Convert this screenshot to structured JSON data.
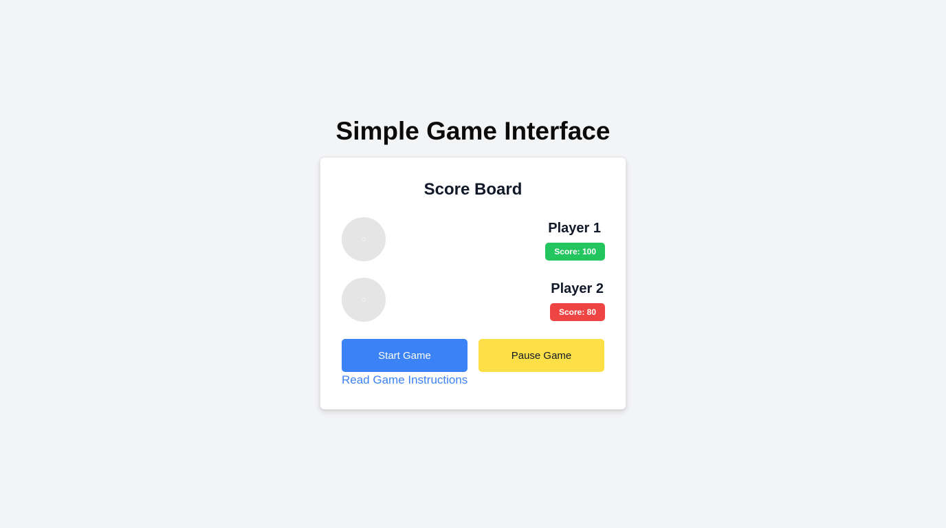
{
  "page": {
    "title": "Simple Game Interface"
  },
  "scoreboard": {
    "title": "Score Board",
    "players": [
      {
        "name": "Player 1",
        "score_label": "Score: 100",
        "score": 100,
        "badge_color": "#22c55e"
      },
      {
        "name": "Player 2",
        "score_label": "Score: 80",
        "score": 80,
        "badge_color": "#ef4444"
      }
    ]
  },
  "actions": {
    "start_label": "Start Game",
    "start_color": "#3b82f6",
    "pause_label": "Pause Game",
    "pause_color": "#fde047",
    "instructions_label": "Read Game Instructions"
  },
  "colors": {
    "background": "#f3f4f6",
    "card": "#ffffff",
    "link": "#3b82f6"
  }
}
